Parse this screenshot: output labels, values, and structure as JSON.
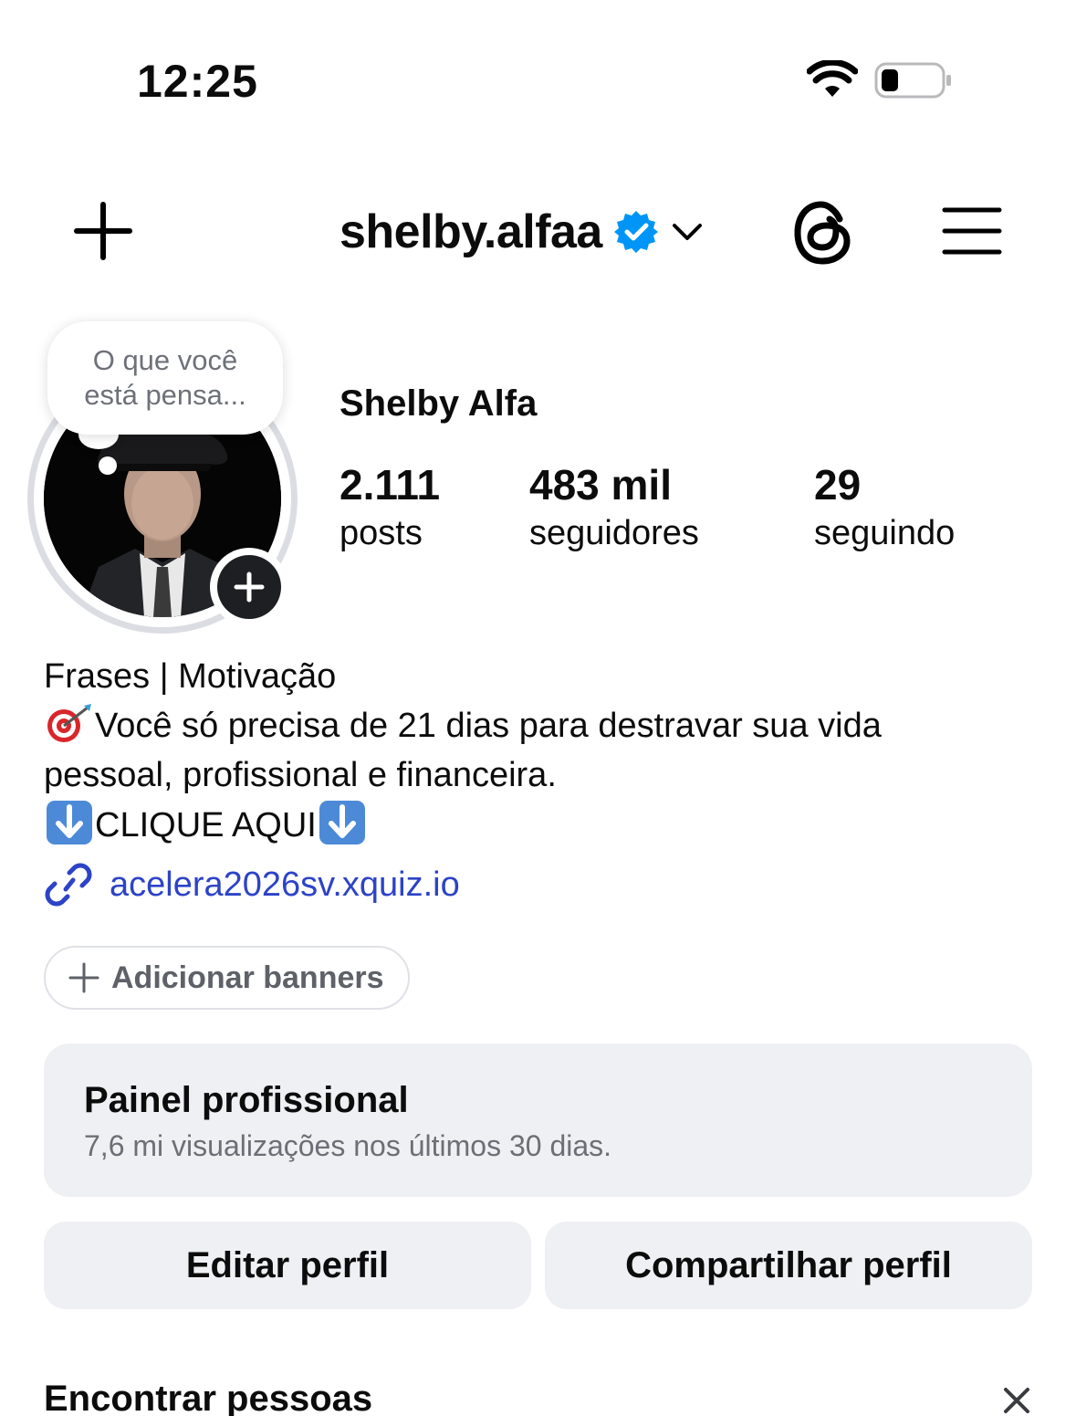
{
  "status_bar": {
    "time": "12:25"
  },
  "header": {
    "username": "shelby.alfaa"
  },
  "profile": {
    "thought_bubble": "O que você está pensa...",
    "full_name": "Shelby Alfa",
    "stats": [
      {
        "value": "2.111",
        "label": "posts"
      },
      {
        "value": "483 mil",
        "label": "seguidores"
      },
      {
        "value": "29",
        "label": "seguindo"
      }
    ],
    "bio": {
      "line1": "Frases | Motivação",
      "line2": "Você só precisa de 21 dias para destravar sua vida",
      "line3": "pessoal, profissional e financeira.",
      "line4": "CLIQUE AQUI"
    },
    "link": "acelera2026sv.xquiz.io",
    "add_banners": "Adicionar banners"
  },
  "pro_panel": {
    "title": "Painel profissional",
    "subtitle": "7,6 mi visualizações nos últimos 30 dias."
  },
  "actions": {
    "edit": "Editar perfil",
    "share": "Compartilhar perfil"
  },
  "suggestions": {
    "title": "Encontrar pessoas"
  },
  "colors": {
    "link": "#2d43c7",
    "verified": "#0095f6",
    "button_bg": "#eff0f3"
  },
  "icons": [
    "wifi-icon",
    "battery-icon",
    "plus-icon",
    "verified-badge-icon",
    "chevron-down-icon",
    "threads-icon",
    "hamburger-menu-icon",
    "target-emoji-icon",
    "down-arrow-emoji-icon",
    "link-icon",
    "close-icon"
  ]
}
